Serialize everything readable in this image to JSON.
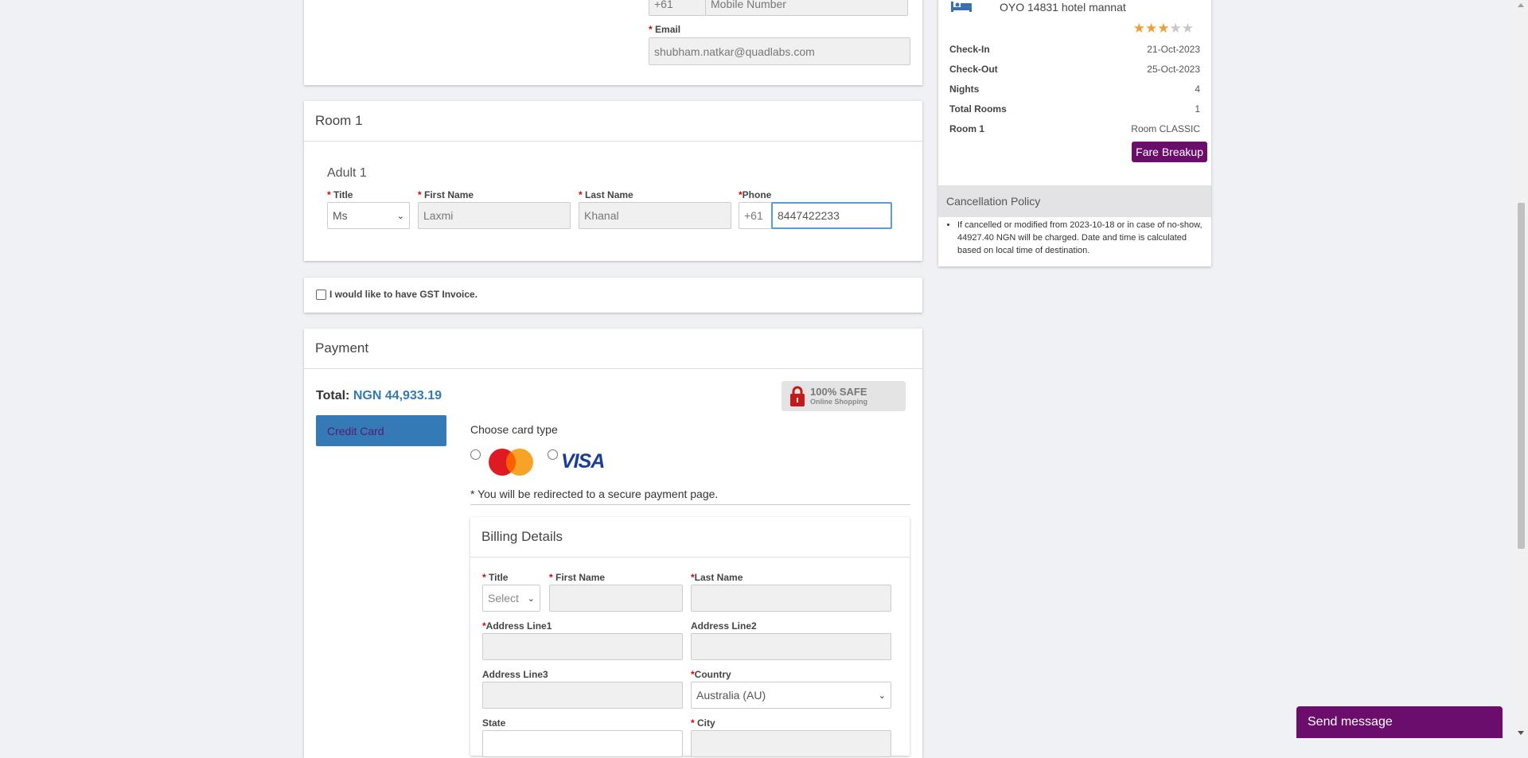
{
  "contact": {
    "phone_code": "+61",
    "mobile_placeholder": "Mobile Number",
    "email_label": "Email",
    "email_value": "shubham.natkar@quadlabs.com"
  },
  "room": {
    "title": "Room 1",
    "adult_title": "Adult 1",
    "labels": {
      "title": "Title",
      "first_name": "First Name",
      "last_name": "Last Name",
      "phone": "Phone"
    },
    "title_value": "Ms",
    "first_name": "Laxmi",
    "last_name": "Khanal",
    "phone_code": "+61",
    "phone": "8447422233"
  },
  "gst": {
    "label": "I would like to have GST Invoice."
  },
  "payment": {
    "title": "Payment",
    "total_label": "Total:",
    "total_value": "NGN 44,933.19",
    "safe_main": "100% SAFE",
    "safe_sub": "Online Shopping",
    "credit_card_label": "Credit Card",
    "choose_card": "Choose card type",
    "visa_text": "VISA",
    "redirect_note": "* You will be redirected to a secure payment page."
  },
  "billing": {
    "title": "Billing Details",
    "labels": {
      "title": "Title",
      "first_name": "First Name",
      "last_name": "Last Name",
      "address1": "Address Line1",
      "address2": "Address Line2",
      "address3": "Address Line3",
      "country": "Country",
      "state": "State",
      "city": "City"
    },
    "title_value": "Select",
    "country_value": "Australia (AU)"
  },
  "summary": {
    "hotel_name": "OYO 14831 hotel mannat",
    "stars": 3,
    "stars_max": 5,
    "rows": [
      {
        "label": "Check-In",
        "value": "21-Oct-2023"
      },
      {
        "label": "Check-Out",
        "value": "25-Oct-2023"
      },
      {
        "label": "Nights",
        "value": "4"
      },
      {
        "label": "Total Rooms",
        "value": "1"
      },
      {
        "label": "Room 1",
        "value": "Room CLASSIC"
      }
    ],
    "fare_breakup": "Fare Breakup",
    "cancellation_title": "Cancellation Policy",
    "cancellation_text": "If cancelled or modified from 2023-10-18 or in case of no-show, 44927.40 NGN will be charged. Date and time is calculated based on local time of destination."
  },
  "chat": {
    "label": "Send message"
  },
  "colors": {
    "purple": "#6b0d6b",
    "blue": "#337ab7",
    "star": "#f0a030"
  }
}
